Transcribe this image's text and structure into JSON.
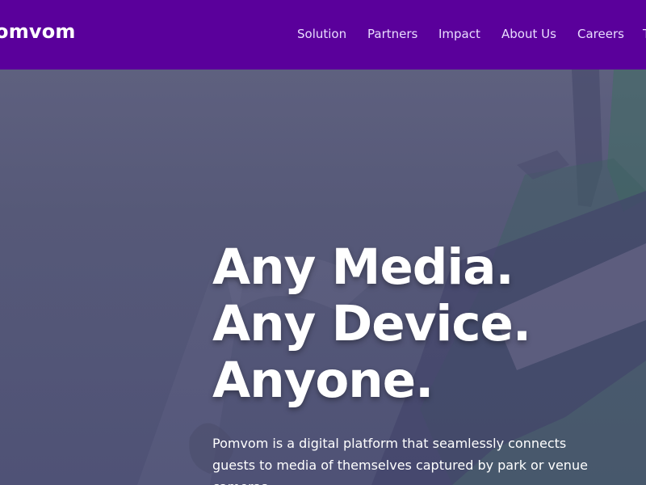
{
  "header": {
    "logo_text": "omvom",
    "nav": [
      "Solution",
      "Partners",
      "Impact",
      "About Us",
      "Careers",
      "T"
    ]
  },
  "hero": {
    "headline": [
      "Any Media.",
      "Any Device.",
      "Anyone."
    ],
    "description": "Pomvom is a digital platform that seamlessly connects guests to media of themselves captured by park or venue cameras."
  },
  "colors": {
    "nav_background": "#5a009b",
    "hero_overlay": "#55587a",
    "text": "#ffffff"
  }
}
